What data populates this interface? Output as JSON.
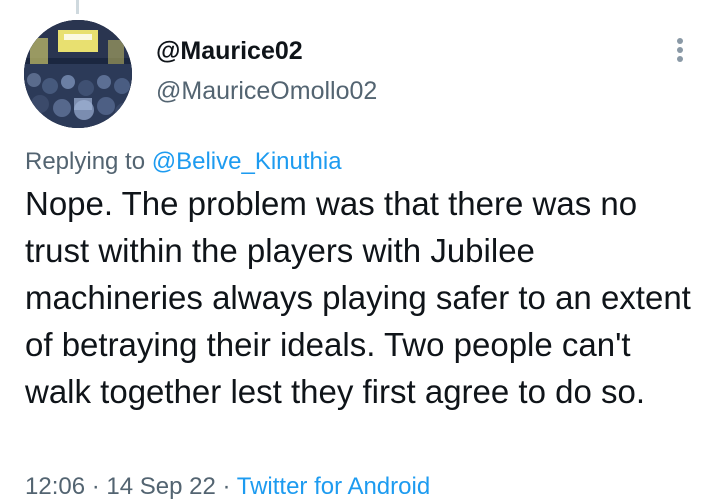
{
  "author": {
    "display_name": "@Maurice02",
    "handle": "@MauriceOmollo02"
  },
  "reply": {
    "prefix": "Replying to",
    "mention": "@Belive_Kinuthia"
  },
  "tweet": {
    "text": "Nope. The problem was that there was no trust within the players with Jubilee machineries always playing safer to an extent of betraying their ideals. Two people can't walk together lest they first agree to do so."
  },
  "meta": {
    "time": "12:06",
    "separator_1": "·",
    "date": "14 Sep 22",
    "separator_2": "·",
    "source": "Twitter for Android"
  },
  "icons": {
    "more": "more-vertical-icon"
  },
  "colors": {
    "link": "#1d9bf0",
    "text_primary": "#0f1419",
    "text_secondary": "#536471"
  }
}
